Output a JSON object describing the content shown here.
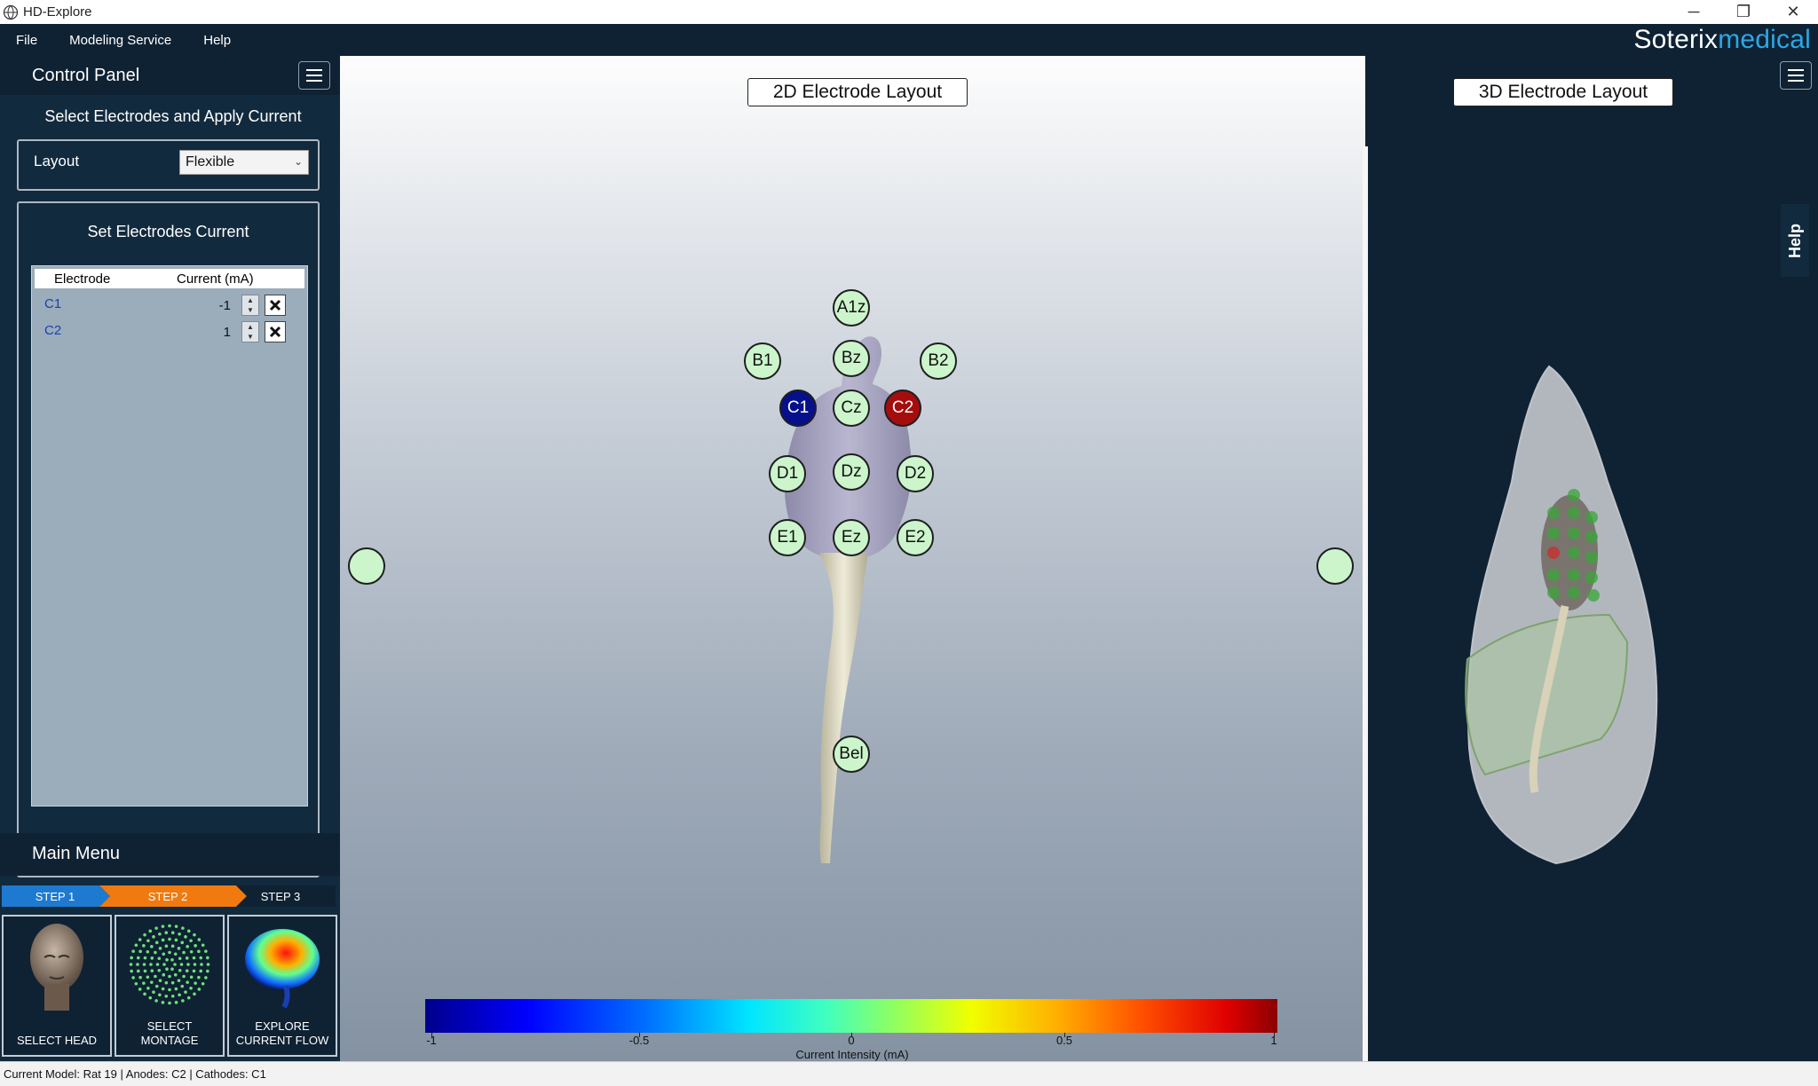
{
  "window": {
    "title": "HD-Explore",
    "controls": [
      "─",
      "❐",
      "✕"
    ]
  },
  "menubar": {
    "items": [
      "File",
      "Modeling Service",
      "Help"
    ],
    "brand_part1": "Soterix",
    "brand_part2": "medical"
  },
  "control_panel": {
    "title": "Control Panel",
    "section_title": "Select Electrodes and Apply Current",
    "layout_label": "Layout",
    "layout_value": "Flexible",
    "electrodes_box_title": "Set Electrodes Current",
    "table_headers": [
      "Electrode",
      "Current (mA)"
    ],
    "rows": [
      {
        "electrode": "C1",
        "current": "-1"
      },
      {
        "electrode": "C2",
        "current": "1"
      }
    ]
  },
  "main_menu": {
    "title": "Main Menu",
    "steps": [
      "STEP 1",
      "STEP 2",
      "STEP 3"
    ],
    "tiles": [
      "SELECT HEAD",
      "SELECT\nMONTAGE",
      "EXPLORE\nCURRENT FLOW"
    ]
  },
  "views": {
    "left_title": "2D Electrode Layout",
    "right_title": "3D Electrode Layout"
  },
  "electrodes": [
    {
      "label": "A1z",
      "role": "none"
    },
    {
      "label": "B1",
      "role": "none"
    },
    {
      "label": "Bz",
      "role": "none"
    },
    {
      "label": "B2",
      "role": "none"
    },
    {
      "label": "C1",
      "role": "cathode"
    },
    {
      "label": "Cz",
      "role": "none"
    },
    {
      "label": "C2",
      "role": "anode"
    },
    {
      "label": "D1",
      "role": "none"
    },
    {
      "label": "Dz",
      "role": "none"
    },
    {
      "label": "D2",
      "role": "none"
    },
    {
      "label": "E1",
      "role": "none"
    },
    {
      "label": "Ez",
      "role": "none"
    },
    {
      "label": "E2",
      "role": "none"
    },
    {
      "label": "Bel",
      "role": "none"
    }
  ],
  "colorbar": {
    "ticks": [
      "-1",
      "-0.5",
      "0",
      "0.5",
      "1"
    ],
    "title": "Current Intensity (mA)",
    "colors": {
      "min": "#00008b",
      "mid": "#90ff60",
      "max": "#8b0000"
    }
  },
  "help_tab": "Help",
  "status": {
    "text": "Current Model: Rat 19 | Anodes: C2 | Cathodes: C1"
  },
  "theme": {
    "dark": "#0f2233",
    "panel": "#122a3e",
    "step1": "#1e7ad0",
    "step2": "#f07a10",
    "cathode": "#06108a",
    "anode": "#a50d0d",
    "electrode": "#ccf5cc"
  }
}
